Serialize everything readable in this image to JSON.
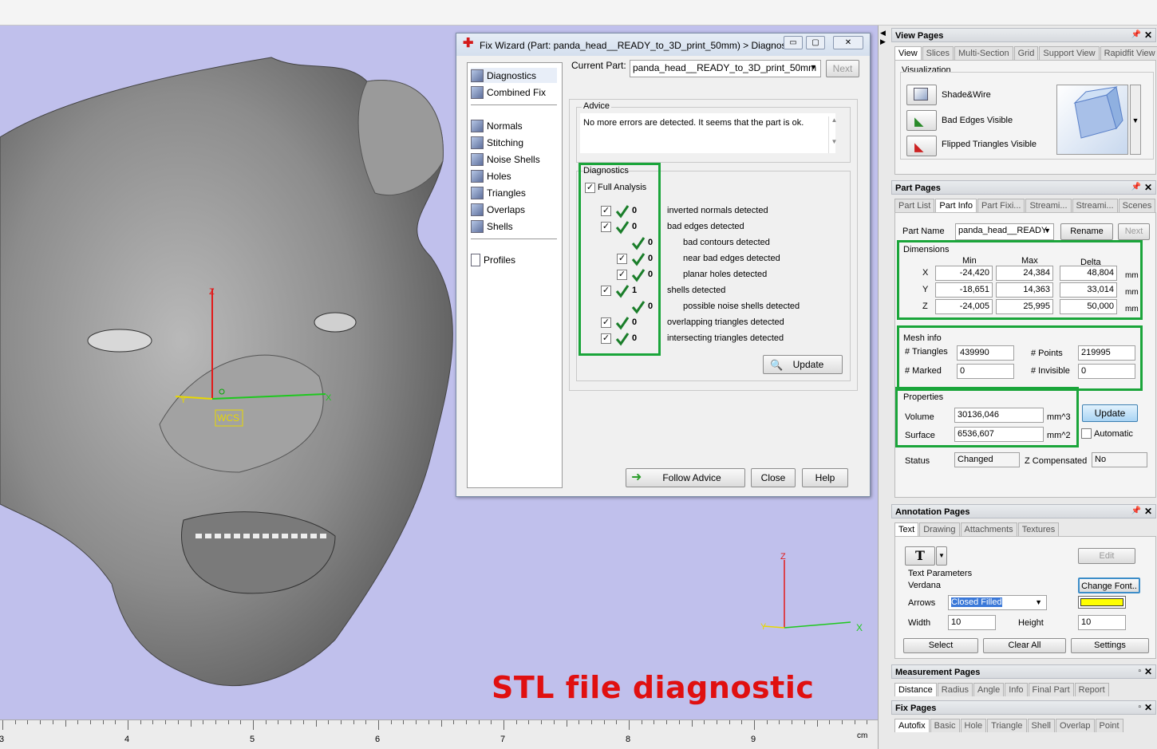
{
  "caption": "STL file diagnostic",
  "ruler": {
    "labels": [
      "3",
      "4",
      "5",
      "6",
      "7",
      "8",
      "9"
    ],
    "unit": "cm"
  },
  "viewport": {
    "wcs_label": "WCS",
    "axis_z": "Z",
    "axis_x": "X",
    "axis_y": "Y",
    "small_z": "Z",
    "small_x": "X",
    "small_y": "Y"
  },
  "wizard": {
    "title": "Fix Wizard (Part: panda_head__READY_to_3D_print_50mm) > Diagnos...",
    "nav_top": [
      "Diagnostics",
      "Combined Fix"
    ],
    "nav_fix": [
      "Normals",
      "Stitching",
      "Noise Shells",
      "Holes",
      "Triangles",
      "Overlaps",
      "Shells"
    ],
    "nav_bottom": [
      "Profiles"
    ],
    "current_part_label": "Current Part:",
    "current_part_value": "panda_head__READY_to_3D_print_50mm",
    "next_label": "Next",
    "advice_label": "Advice",
    "advice_text": "No more errors are detected. It seems that the part is ok.",
    "diagnostics_label": "Diagnostics",
    "full_analysis": "Full Analysis",
    "rows": [
      {
        "count": "0",
        "text": "inverted normals detected"
      },
      {
        "count": "0",
        "text": "bad edges detected"
      },
      {
        "count": "0",
        "text": "bad contours detected"
      },
      {
        "count": "0",
        "text": "near bad edges detected"
      },
      {
        "count": "0",
        "text": "planar holes detected"
      },
      {
        "count": "1",
        "text": "shells detected"
      },
      {
        "count": "0",
        "text": "possible noise shells detected"
      },
      {
        "count": "0",
        "text": "overlapping triangles detected"
      },
      {
        "count": "0",
        "text": "intersecting triangles detected"
      }
    ],
    "update_label": "Update",
    "follow_advice": "Follow Advice",
    "close": "Close",
    "help": "Help"
  },
  "view_pages": {
    "title": "View Pages",
    "tabs": [
      "View",
      "Slices",
      "Multi-Section",
      "Grid",
      "Support View",
      "Rapidfit View"
    ],
    "visualization": "Visualization",
    "items": [
      "Shade&Wire",
      "Bad Edges Visible",
      "Flipped Triangles Visible"
    ]
  },
  "part_pages": {
    "title": "Part Pages",
    "tabs": [
      "Part List",
      "Part Info",
      "Part Fixi...",
      "Streami...",
      "Streami...",
      "Scenes"
    ],
    "part_name_label": "Part Name",
    "part_name_value": "panda_head__READY",
    "rename": "Rename",
    "next": "Next",
    "dimensions": "Dimensions",
    "headers": [
      "Min",
      "Max",
      "Delta"
    ],
    "axes": [
      "X",
      "Y",
      "Z"
    ],
    "dims": [
      [
        "-24,420",
        "24,384",
        "48,804"
      ],
      [
        "-18,651",
        "14,363",
        "33,014"
      ],
      [
        "-24,005",
        "25,995",
        "50,000"
      ]
    ],
    "unit": "mm",
    "mesh_info": "Mesh info",
    "triangles_label": "# Triangles",
    "triangles": "439990",
    "points_label": "# Points",
    "points": "219995",
    "marked_label": "# Marked",
    "marked": "0",
    "invisible_label": "# Invisible",
    "invisible": "0",
    "properties": "Properties",
    "volume_label": "Volume",
    "volume": "30136,046",
    "volume_unit": "mm^3",
    "surface_label": "Surface",
    "surface": "6536,607",
    "surface_unit": "mm^2",
    "update": "Update",
    "automatic": "Automatic",
    "status_label": "Status",
    "status": "Changed",
    "zcomp_label": "Z Compensated",
    "zcomp": "No"
  },
  "annotation_pages": {
    "title": "Annotation Pages",
    "tabs": [
      "Text",
      "Drawing",
      "Attachments",
      "Textures"
    ],
    "edit": "Edit",
    "text_params": "Text Parameters",
    "font": "Verdana",
    "arrows_label": "Arrows",
    "arrows_value": "Closed Filled",
    "change_font": "Change Font..",
    "width_label": "Width",
    "width": "10",
    "height_label": "Height",
    "height": "10",
    "select": "Select",
    "clear_all": "Clear All",
    "settings": "Settings",
    "swatch_color": "#ffff00"
  },
  "measurement_pages": {
    "title": "Measurement Pages",
    "tabs": [
      "Distance",
      "Radius",
      "Angle",
      "Info",
      "Final Part",
      "Report"
    ]
  },
  "fix_pages": {
    "title": "Fix Pages",
    "tabs": [
      "Autofix",
      "Basic",
      "Hole",
      "Triangle",
      "Shell",
      "Overlap",
      "Point"
    ]
  }
}
